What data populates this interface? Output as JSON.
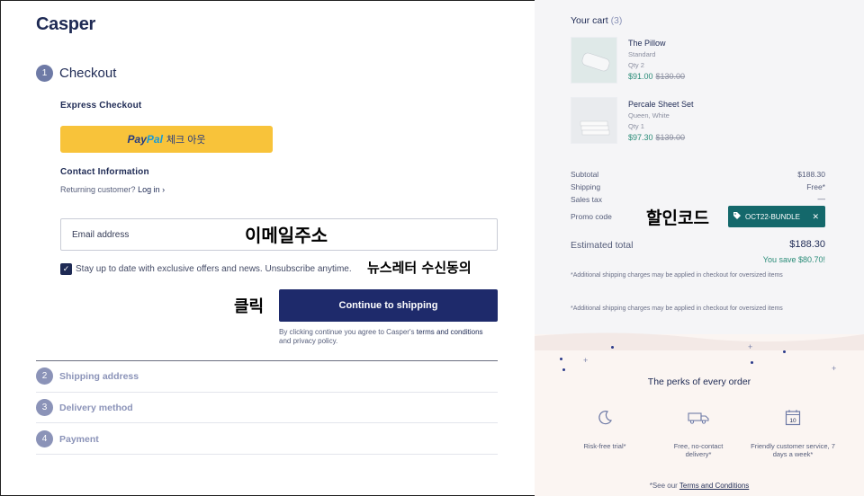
{
  "brand": {
    "logo": "Casper"
  },
  "checkout": {
    "step_number": "1",
    "title": "Checkout",
    "express_label": "Express Checkout",
    "paypal": {
      "logo_part1": "Pay",
      "logo_part2": "Pal",
      "text": "체크 아웃"
    },
    "contact_label": "Contact Information",
    "returning_text": "Returning customer?",
    "login_text": "Log in",
    "email_placeholder": "Email address",
    "newsletter_text": "Stay up to date with exclusive offers and news. Unsubscribe anytime.",
    "continue_label": "Continue to shipping",
    "disclaimer_pre": "By clicking continue you agree to Casper's",
    "disclaimer_link": "terms and conditions",
    "disclaimer_post": "and privacy policy."
  },
  "annotations": {
    "email": "이메일주소",
    "newsletter": "뉴스레터 수신동의",
    "click": "클릭",
    "promo": "할인코드"
  },
  "steps": [
    {
      "num": "2",
      "label": "Shipping address"
    },
    {
      "num": "3",
      "label": "Delivery method"
    },
    {
      "num": "4",
      "label": "Payment"
    }
  ],
  "cart": {
    "title": "Your cart",
    "count": "(3)",
    "items": [
      {
        "name": "The Pillow",
        "variant": "Standard",
        "qty": "Qty 2",
        "price": "$91.00",
        "old_price": "$130.00"
      },
      {
        "name": "Percale Sheet Set",
        "variant": "Queen, White",
        "qty": "Qty 1",
        "price": "$97.30",
        "old_price": "$139.00"
      }
    ],
    "summary": {
      "subtotal_label": "Subtotal",
      "subtotal": "$188.30",
      "shipping_label": "Shipping",
      "shipping": "Free*",
      "tax_label": "Sales tax",
      "tax": "—",
      "promo_label": "Promo code",
      "promo_code": "OCT22-BUNDLE",
      "estimated_label": "Estimated total",
      "estimated": "$188.30",
      "savings": "You save $80.70!",
      "note1": "*Additional shipping charges may be applied in checkout for oversized items",
      "note2": "*Additional shipping charges may be applied in checkout for oversized items"
    }
  },
  "perks": {
    "title": "The perks of every order",
    "items": [
      {
        "label": "Risk-free trial*",
        "icon": "moon-icon"
      },
      {
        "label": "Free, no-contact delivery*",
        "icon": "truck-icon"
      },
      {
        "label": "Friendly customer service, 7 days a week*",
        "icon": "calendar-icon",
        "calendar_day": "10"
      }
    ],
    "terms_pre": "*See our",
    "terms_link": "Terms and Conditions"
  },
  "colors": {
    "navy": "#1e2a6b",
    "paypal_yellow": "#f8c33a",
    "teal": "#14686b",
    "green": "#2a8c78"
  }
}
